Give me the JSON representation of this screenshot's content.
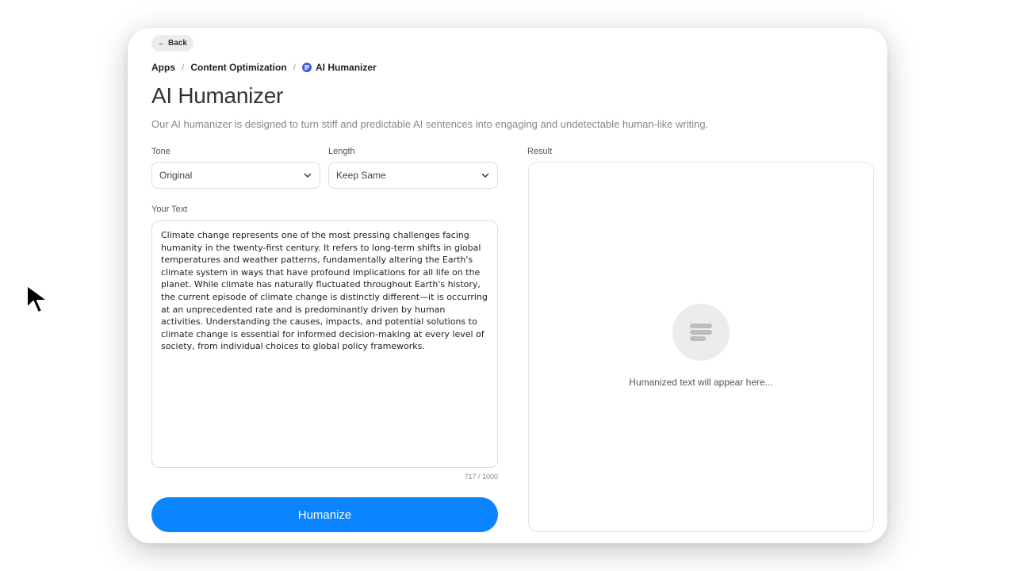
{
  "nav": {
    "back_label": "Back"
  },
  "breadcrumb": {
    "items": [
      "Apps",
      "Content Optimization",
      "AI Humanizer"
    ],
    "separator": "/"
  },
  "page": {
    "title": "AI Humanizer",
    "description": "Our AI humanizer is designed to turn stiff and predictable AI sentences into engaging and undetectable human-like writing."
  },
  "form": {
    "tone_label": "Tone",
    "tone_value": "Original",
    "length_label": "Length",
    "length_value": "Keep Same",
    "text_label": "Your Text",
    "text_value": "Climate change represents one of the most pressing challenges facing humanity in the twenty-first century. It refers to long-term shifts in global temperatures and weather patterns, fundamentally altering the Earth's climate system in ways that have profound implications for all life on the planet. While climate has naturally fluctuated throughout Earth's history, the current episode of climate change is distinctly different—it is occurring at an unprecedented rate and is predominantly driven by human activities. Understanding the causes, impacts, and potential solutions to climate change is essential for informed decision-making at every level of society, from individual choices to global policy frameworks.",
    "char_count": "717 / 1000",
    "submit_label": "Humanize"
  },
  "result": {
    "label": "Result",
    "placeholder": "Humanized text will appear here..."
  },
  "colors": {
    "accent": "#0a84ff",
    "app_icon": "#3b5bdb"
  }
}
